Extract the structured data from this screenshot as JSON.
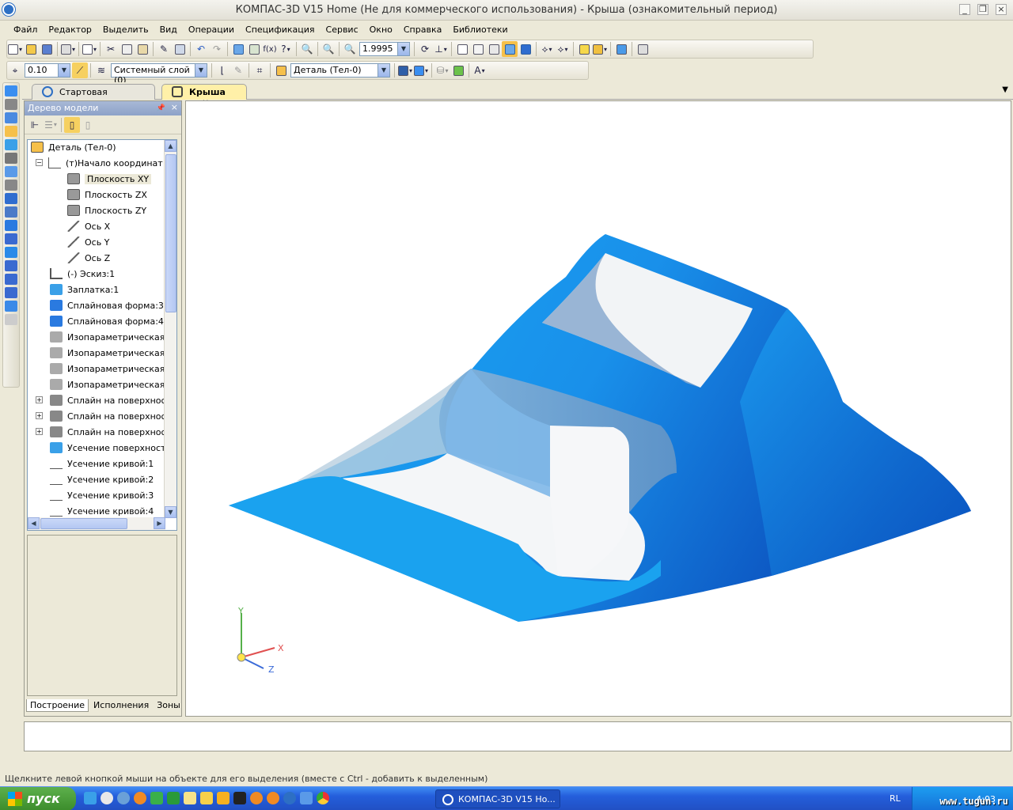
{
  "window": {
    "title": "КОМПАС-3D V15 Home (Не для коммерческого использования) - Крыша (ознакомительный период)"
  },
  "menu": [
    "Файл",
    "Редактор",
    "Выделить",
    "Вид",
    "Операции",
    "Спецификация",
    "Сервис",
    "Окно",
    "Справка",
    "Библиотеки"
  ],
  "toolbar": {
    "zoom_value": "1.9995",
    "step_value": "0.10",
    "layer_value": "Системный слой (0)",
    "detail_value": "Деталь (Тел-0)"
  },
  "tabs": [
    {
      "label": "Стартовая страница"
    },
    {
      "label": "Крыша",
      "close": "×"
    }
  ],
  "tree_panel": {
    "title": "Дерево модели",
    "pin": "📌",
    "close": "×"
  },
  "tree": [
    {
      "label": "Деталь (Тел-0)"
    },
    {
      "label": "(т)Начало координат"
    },
    {
      "label": "Плоскость XY"
    },
    {
      "label": "Плоскость ZX"
    },
    {
      "label": "Плоскость ZY"
    },
    {
      "label": "Ось X"
    },
    {
      "label": "Ось Y"
    },
    {
      "label": "Ось Z"
    },
    {
      "label": "(-) Эскиз:1"
    },
    {
      "label": "Заплатка:1"
    },
    {
      "label": "Сплайновая форма:3"
    },
    {
      "label": "Сплайновая форма:4"
    },
    {
      "label": "Изопараметрическая кр"
    },
    {
      "label": "Изопараметрическая кр"
    },
    {
      "label": "Изопараметрическая кр"
    },
    {
      "label": "Изопараметрическая кр"
    },
    {
      "label": "Сплайн на поверхности"
    },
    {
      "label": "Сплайн на поверхности"
    },
    {
      "label": "Сплайн на поверхности"
    },
    {
      "label": "Усечение поверхности:"
    },
    {
      "label": "Усечение кривой:1"
    },
    {
      "label": "Усечение кривой:2"
    },
    {
      "label": "Усечение кривой:3"
    },
    {
      "label": "Усечение кривой:4"
    }
  ],
  "panel_tabs": [
    "Построение",
    "Исполнения",
    "Зоны"
  ],
  "axes": {
    "x": "X",
    "y": "Y",
    "z": "Z"
  },
  "status": "Щелкните левой кнопкой мыши на объекте для его выделения (вместе с Ctrl - добавить к выделенным)",
  "taskbar": {
    "start": "пуск",
    "task": "КОМПАС-3D V15 Ho...",
    "lang": "RL",
    "clock": "4:03",
    "watermark": "www.tugun.ru"
  },
  "colors": {
    "model_light": "#1aa6f2",
    "model_dark": "#0a4fbd",
    "accent": "#2d6fc4"
  }
}
